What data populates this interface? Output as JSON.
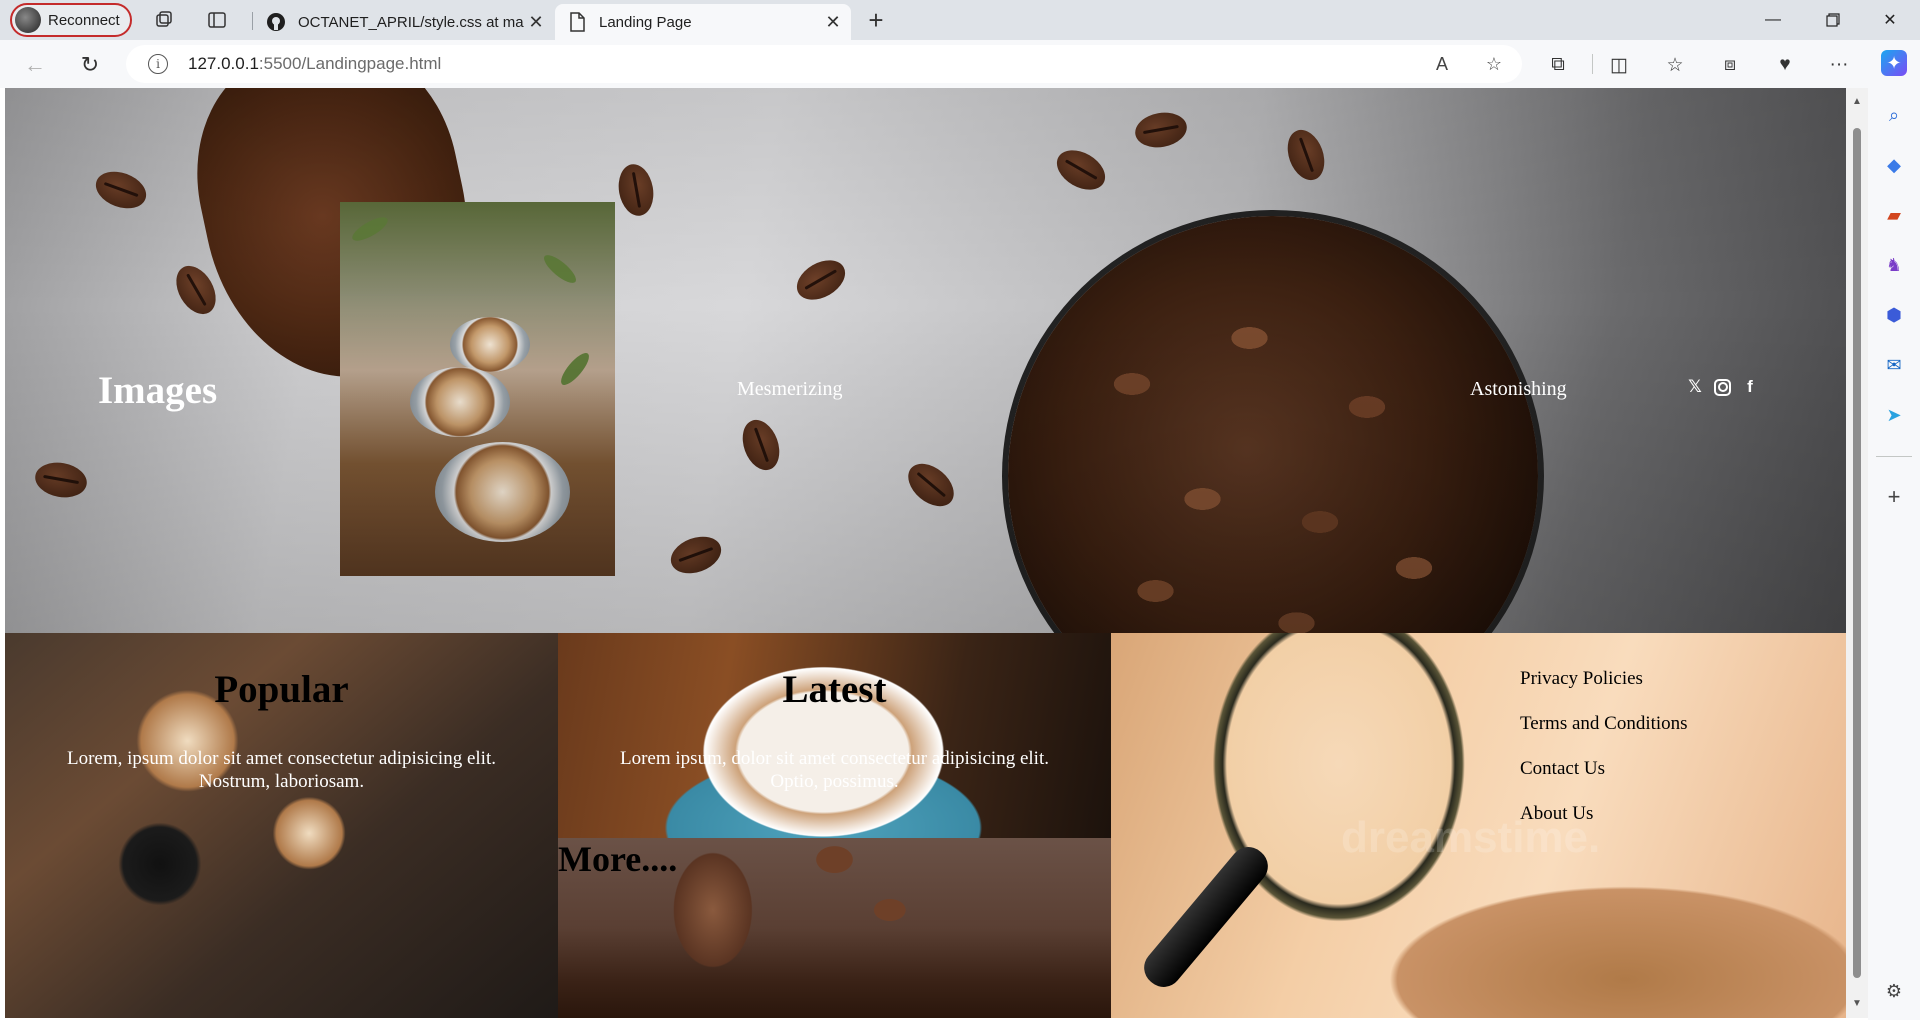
{
  "browser": {
    "profile_label": "Reconnect",
    "tabs": [
      {
        "title": "OCTANET_APRIL/style.css at main",
        "active": false
      },
      {
        "title": "Landing Page",
        "active": true
      }
    ],
    "address": {
      "host": "127.0.0.1",
      "rest": ":5500/Landingpage.html"
    }
  },
  "hero": {
    "brand": "Images",
    "links": [
      "Mesmerizing",
      "Astonishing"
    ],
    "social_icons": [
      "x-icon",
      "instagram-icon",
      "facebook-icon"
    ]
  },
  "sections": {
    "popular": {
      "title": "Popular",
      "text": "Lorem, ipsum dolor sit amet consectetur adipisicing elit. Nostrum, laboriosam."
    },
    "latest": {
      "title": "Latest",
      "text": "Lorem ipsum, dolor sit amet consectetur adipisicing elit. Optio, possimus."
    },
    "more": {
      "title": "More...."
    },
    "footer_links": [
      "Privacy Policies",
      "Terms and Conditions",
      "Contact Us",
      "About Us"
    ],
    "watermark": "dreamstime."
  },
  "colors": {
    "accent_profile_border": "#c42b2b",
    "hero_text": "#ffffff",
    "panel_title": "#000000"
  }
}
